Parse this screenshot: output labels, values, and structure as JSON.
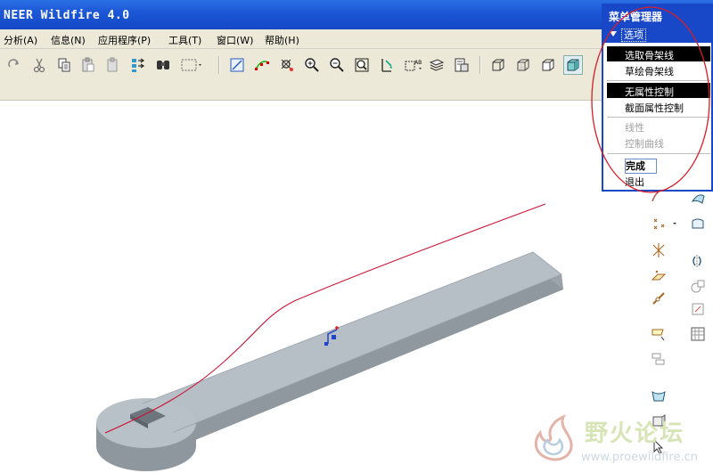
{
  "app": {
    "title": "NEER Wildfire 4.0"
  },
  "menubar": {
    "items": [
      {
        "label": "分析(A)"
      },
      {
        "label": "信息(N)"
      },
      {
        "label": "应用程序(P)"
      },
      {
        "label": "工具(T)"
      },
      {
        "label": "窗口(W)"
      },
      {
        "label": "帮助(H)"
      }
    ]
  },
  "toolbar": {
    "icons": [
      "redo-icon",
      "cut-icon",
      "copy-icon",
      "paste-icon",
      "paste-special-icon",
      "regenerate-icon",
      "find-icon",
      "select-box-icon",
      "display-datum-icon",
      "spline-icon",
      "spin-center-icon",
      "zoom-in-icon",
      "zoom-out-icon",
      "refit-icon",
      "orient-icon",
      "annotation-icon",
      "layers-icon",
      "view-manager-icon",
      "wireframe-icon",
      "hidden-line-icon",
      "no-hidden-icon",
      "shaded-icon"
    ]
  },
  "menu_manager": {
    "title": "菜单管理器",
    "section": "选项",
    "items": [
      {
        "label": "选取骨架线",
        "selected": true,
        "enabled": true
      },
      {
        "label": "草绘骨架线",
        "selected": false,
        "enabled": true
      },
      {
        "label": "无属性控制",
        "selected": true,
        "enabled": true
      },
      {
        "label": "截面属性控制",
        "selected": false,
        "enabled": true
      },
      {
        "label": "线性",
        "selected": false,
        "enabled": false
      },
      {
        "label": "控制曲线",
        "selected": false,
        "enabled": false
      }
    ],
    "done": "完成",
    "exit": "退出"
  },
  "watermark": {
    "text": "野火论坛",
    "url": "www.proewildfire.cn"
  },
  "colors": {
    "titlebar": "#1c58d6",
    "menumgr_border": "#1848c8",
    "spine_curve": "#cc1133",
    "model_top": "#b4bcc4",
    "model_side": "#8e969e",
    "annotation": "#d81e2a"
  }
}
